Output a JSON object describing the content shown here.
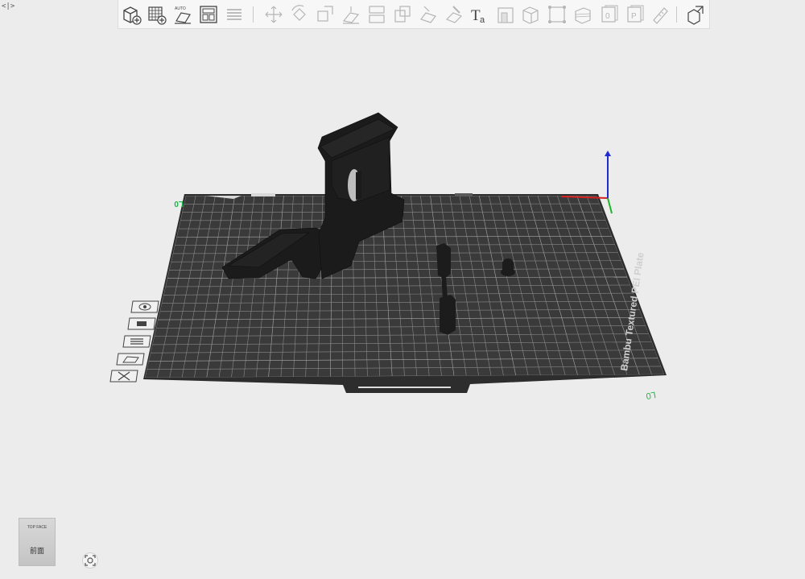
{
  "corner_toggle": "<|>",
  "toolbar": {
    "groups": [
      [
        "add-object",
        "add-plate",
        "auto-orient",
        "arrange",
        "split-layers"
      ],
      [
        "move",
        "rotate",
        "scale",
        "place-on-face",
        "cut",
        "split-objects",
        "lay-flat",
        "paint-support",
        "text",
        "emboss",
        "add-part",
        "negative-part",
        "modifier",
        "support-blocker",
        "support-enforcer",
        "measure"
      ],
      [
        "assemble"
      ]
    ]
  },
  "plate": {
    "brand_text": "Bambu Textured PEI Plate",
    "corner_label_left": "L0",
    "corner_label_right": "L0"
  },
  "side_tools": [
    "view-orientation",
    "paint-seam",
    "layers-slider",
    "plate-settings",
    "close-view"
  ],
  "navcube": {
    "top_text": "TOP FACE",
    "face_label": "前面"
  },
  "colors": {
    "plate": "#343434",
    "grid": "#7f7f7f",
    "model": "#1a1a1a",
    "axis_x": "#d62020",
    "axis_y": "#1fb52a",
    "axis_z": "#1f2ad0",
    "background": "#ececec"
  }
}
